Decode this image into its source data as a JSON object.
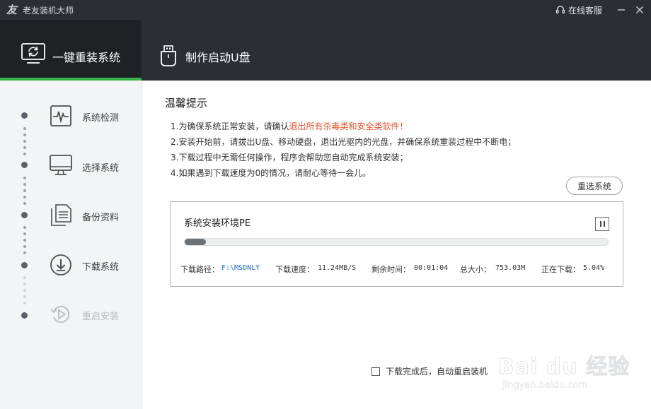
{
  "app": {
    "title": "老友装机大师",
    "logo_glyph": "友",
    "support_label": "在线客服"
  },
  "tabs": [
    {
      "label": "一键重装系统",
      "active": true
    },
    {
      "label": "制作启动U盘",
      "active": false
    }
  ],
  "steps": [
    {
      "label": "系统检测",
      "icon": "heartbeat-monitor-icon",
      "enabled": true
    },
    {
      "label": "选择系统",
      "icon": "monitor-icon",
      "enabled": true
    },
    {
      "label": "备份资料",
      "icon": "documents-icon",
      "enabled": true
    },
    {
      "label": "下载系统",
      "icon": "download-circle-icon",
      "enabled": true
    },
    {
      "label": "重启安装",
      "icon": "restart-play-icon",
      "enabled": false
    }
  ],
  "tips": {
    "title": "温馨提示",
    "line1_prefix": "1.为确保系统正常安装，请确认",
    "line1_warning": "退出所有杀毒类和安全类软件！",
    "line2": "2.安装开始前，请拔出U盘、移动硬盘，退出光驱内的光盘，并确保系统重装过程中不断电；",
    "line3": "3.下载过程中无需任何操作，程序会帮助您自动完成系统安装；",
    "line4": "4.如果遇到下载速度为0的情况，请耐心等待一会儿。"
  },
  "reselect_label": "重选系统",
  "download": {
    "title": "系统安装环境PE",
    "progress_percent": 5.04,
    "path_label": "下载路径：",
    "path_value": "F:\\MSDNLY",
    "speed_label": "下载速度：",
    "speed_value": "11.24MB/S",
    "remaining_label": "剩余时间：",
    "remaining_value": "00:01:04",
    "size_label": "总大小：",
    "size_value": "753.03M",
    "status_label": "正在下载：",
    "status_value": "5.04%"
  },
  "auto_restart_label": "下载完成后，自动重启装机",
  "watermark": {
    "logo_text": "Bai du 经验",
    "url": "jingyan.baidu.com"
  },
  "colors": {
    "titlebar": "#2b2f33",
    "active_tab": "#1f2225",
    "accent_green": "#37b24d",
    "warning_red": "#e8542c",
    "path_blue": "#1a6fc9"
  }
}
